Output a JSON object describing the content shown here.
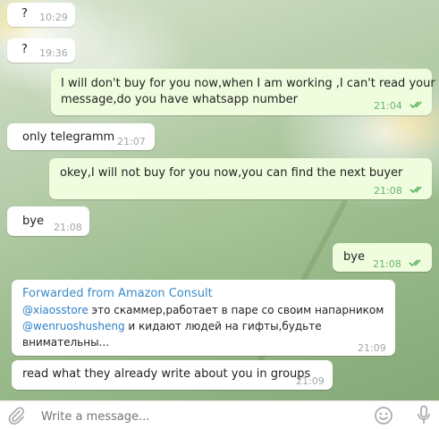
{
  "messages": [
    {
      "text": "?",
      "time": "10:29",
      "outgoing": false
    },
    {
      "text": "?",
      "time": "19:36",
      "outgoing": false
    },
    {
      "text_line1": "I will don't buy for you now,when I am working ,I can't read your",
      "text_line2": "message,do you have whatsapp number",
      "time": "21:04",
      "outgoing": true
    },
    {
      "text": "only telegramm",
      "time": "21:07",
      "outgoing": false
    },
    {
      "text": "okey,I will not buy for you now,you can find the next buyer",
      "time": "21:08",
      "outgoing": true
    },
    {
      "text": "bye",
      "time": "21:08",
      "outgoing": false
    },
    {
      "text": "bye",
      "time": "21:08",
      "outgoing": true
    },
    {
      "forwarded_from": "Forwarded from Amazon Consult",
      "mention1": "@xiaosstore",
      "text1": " это скаммер,работает в паре со своим напарником",
      "mention2": "@wenruoshusheng",
      "text2": " и кидают людей на гифты,будьте",
      "text3": "внимательны...",
      "time": "21:09",
      "outgoing": false
    },
    {
      "text": "read what they already write about you in groups",
      "time": "21:09",
      "outgoing": false
    }
  ],
  "input": {
    "placeholder": "Write a message..."
  },
  "colors": {
    "outgoing_bubble": "#effdde",
    "incoming_bubble": "#ffffff",
    "link": "#2a7fc8",
    "read_ticks": "#5eb45f"
  },
  "icons": {
    "attach": "paperclip-icon",
    "emoji": "smiley-icon",
    "voice": "microphone-icon",
    "read_status": "double-check-icon"
  }
}
